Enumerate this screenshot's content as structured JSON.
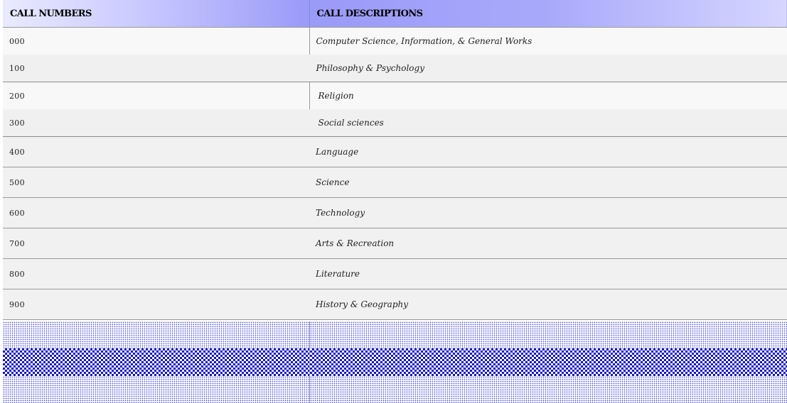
{
  "table": {
    "headers": {
      "call_numbers": "CALL NUMBERS",
      "call_descriptions": "CALL DESCRIPTIONS"
    },
    "rows": [
      {
        "number": "000",
        "description": "Computer Science, Information, & General Works"
      },
      {
        "number": "100",
        "description": "Philosophy & Psychology"
      },
      {
        "number": "200",
        "description": "Religion"
      },
      {
        "number": "300",
        "description": "Social sciences"
      },
      {
        "number": "400",
        "description": "Language"
      },
      {
        "number": "500",
        "description": "Science"
      },
      {
        "number": "600",
        "description": "Technology"
      },
      {
        "number": "700",
        "description": "Arts & Recreation"
      },
      {
        "number": "800",
        "description": "Literature"
      },
      {
        "number": "900",
        "description": "History & Geography"
      }
    ]
  },
  "colors": {
    "header_accent": "#9a9af8",
    "pattern_blue": "#1414c8"
  }
}
